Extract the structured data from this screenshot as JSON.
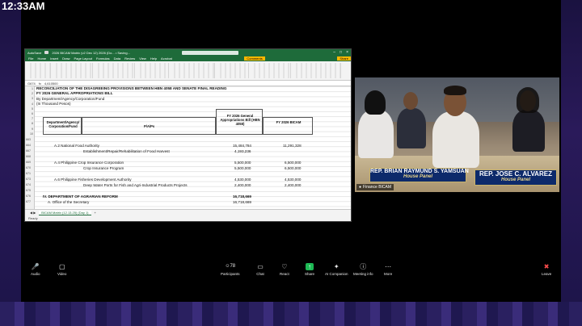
{
  "clock": "12:33AM",
  "excel": {
    "title": "2026 BICAM Matrix (v2 Dec 12) 2026 (Do... • Saving...",
    "autosave": "AutoSave",
    "menu": [
      "File",
      "Home",
      "Insert",
      "Draw",
      "Page Layout",
      "Formulas",
      "Data",
      "Review",
      "View",
      "Help",
      "Acrobat"
    ],
    "comments": "Comments",
    "share": "Share",
    "cell_ref": "G674",
    "formula": "4,610500",
    "heading1": "RECONCILIATION OF THE DISAGREEING PROVISIONS BETWEEN HBN 4058 AND SENATE FINAL READING",
    "heading2": "FY 2026 GENERAL APPROPRIATIONS BILL",
    "heading3": "By Department/Agency/Corporation/Fund",
    "heading4": "(In Thousand Pesos)",
    "col_dept": "Department/Agency/ Corporation/Fund",
    "col_paps": "P/A/Ps",
    "col_gab": "FY 2026 General Appropriations Bill (HBN 4058)",
    "col_bicam": "FY 2026 BICAM",
    "rows": [
      {
        "num": "663",
        "dept": "",
        "pap": "",
        "gab": "",
        "bicam": ""
      },
      {
        "num": "664",
        "dept": "A.2 National Food Authority",
        "pap": "",
        "gab": "15,484,784",
        "bicam": "11,291,328"
      },
      {
        "num": "667",
        "dept": "",
        "pap": "Establishment/Repair/Rehabilitation of Food Harvest",
        "gab": "4,193,236",
        "bicam": ""
      },
      {
        "num": "668",
        "dept": "",
        "pap": "",
        "gab": "",
        "bicam": ""
      },
      {
        "num": "669",
        "dept": "A.4 Philippine Crop Insurance Corporation",
        "pap": "",
        "gab": "5,500,000",
        "bicam": "6,500,000"
      },
      {
        "num": "670",
        "dept": "",
        "pap": "Crop Insurance Program",
        "gab": "5,500,000",
        "bicam": "6,500,000"
      },
      {
        "num": "671",
        "dept": "",
        "pap": "",
        "gab": "",
        "bicam": ""
      },
      {
        "num": "673",
        "dept": "A.6 Philippine Fisheries Development Authority",
        "pap": "",
        "gab": "4,530,000",
        "bicam": "4,530,000"
      },
      {
        "num": "674",
        "dept": "",
        "pap": "Deep Water Ports for Fish and Agri-Industrial Products Projects",
        "gab": "2,400,000",
        "bicam": "2,400,000"
      },
      {
        "num": "675",
        "dept": "",
        "pap": "",
        "gab": "",
        "bicam": ""
      },
      {
        "num": "676",
        "dept": "IV. DEPARTMENT OF AGRARIAN REFORM",
        "pap": "",
        "gab": "16,718,669",
        "bicam": ""
      },
      {
        "num": "677",
        "dept": "A. Office of the Secretary",
        "pap": "",
        "gab": "16,718,669",
        "bicam": ""
      }
    ],
    "sheet_tab": "BICAM Matrix (12.13.25) (Day 1)",
    "status": "Ready"
  },
  "camera": {
    "plate1_name": "REP. BRIAN RAYMUND S. YAMSUAN",
    "plate1_sub": "House Panel",
    "plate2_name": "REP. JOSE C. ALVAREZ",
    "plate2_sub": "House Panel",
    "label": "Finance BICAM"
  },
  "toolbar": {
    "audio": "Audio",
    "video": "Video",
    "participants": "Participants",
    "participants_count": "78",
    "chat": "Chat",
    "react": "React",
    "share": "Share",
    "ai": "AI Companion",
    "meeting_info": "Meeting info",
    "more": "More",
    "leave": "Leave"
  }
}
